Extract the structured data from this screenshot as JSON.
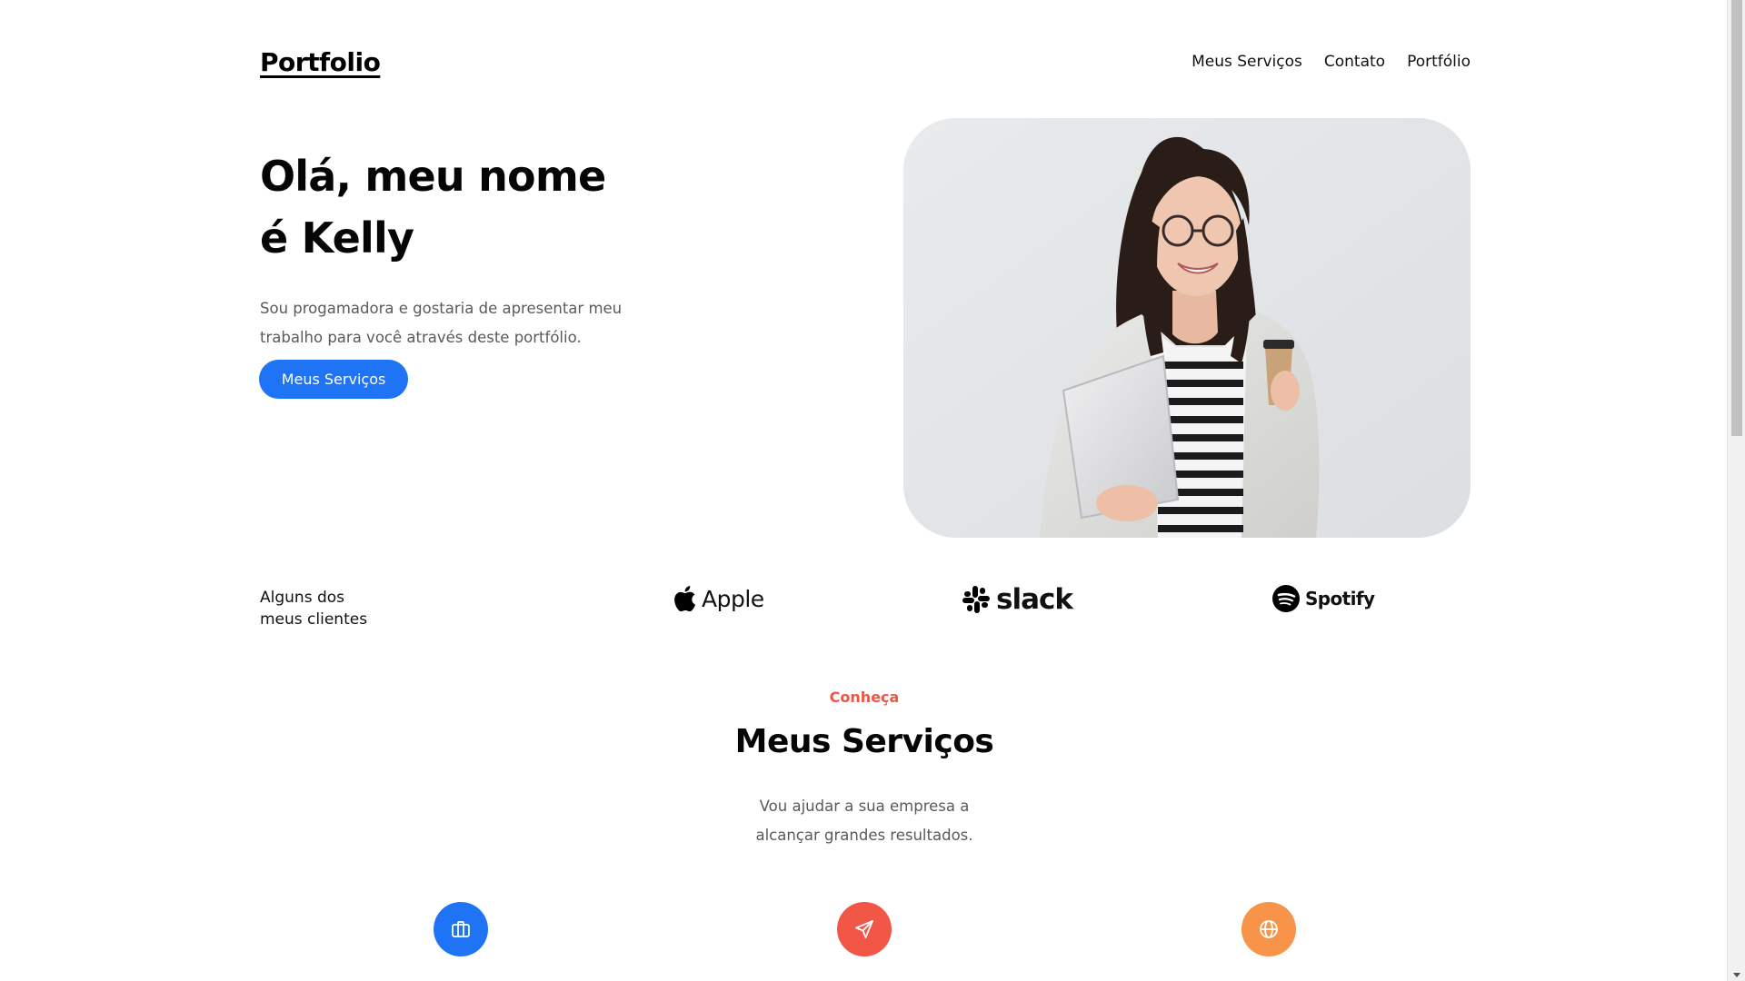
{
  "header": {
    "logo": "Portfolio",
    "nav": [
      "Meus Serviços",
      "Contato",
      "Portfólio"
    ]
  },
  "hero": {
    "title_line1": "Olá, meu nome",
    "title_line2": "é Kelly",
    "description": "Sou progamadora e gostaria de apresentar meu trabalho para você através deste portfólio.",
    "button_label": "Meus Serviços",
    "image": "woman-holding-laptop-and-coffee-photo"
  },
  "clients": {
    "label_line1": "Alguns dos",
    "label_line2": "meus clientes",
    "logos": [
      "Apple",
      "slack",
      "Spotify"
    ]
  },
  "services": {
    "kicker": "Conheça",
    "title": "Meus Serviços",
    "desc_line1": "Vou ajudar a sua empresa a",
    "desc_line2": "alcançar grandes resultados.",
    "icons": [
      {
        "name": "briefcase-icon",
        "color": "#1f74f5"
      },
      {
        "name": "send-icon",
        "color": "#f25647"
      },
      {
        "name": "globe-icon",
        "color": "#f7944a"
      }
    ]
  },
  "colors": {
    "accent_blue": "#1f74f5",
    "accent_red": "#f25647",
    "accent_orange": "#f7944a",
    "kicker": "#ef5645"
  }
}
